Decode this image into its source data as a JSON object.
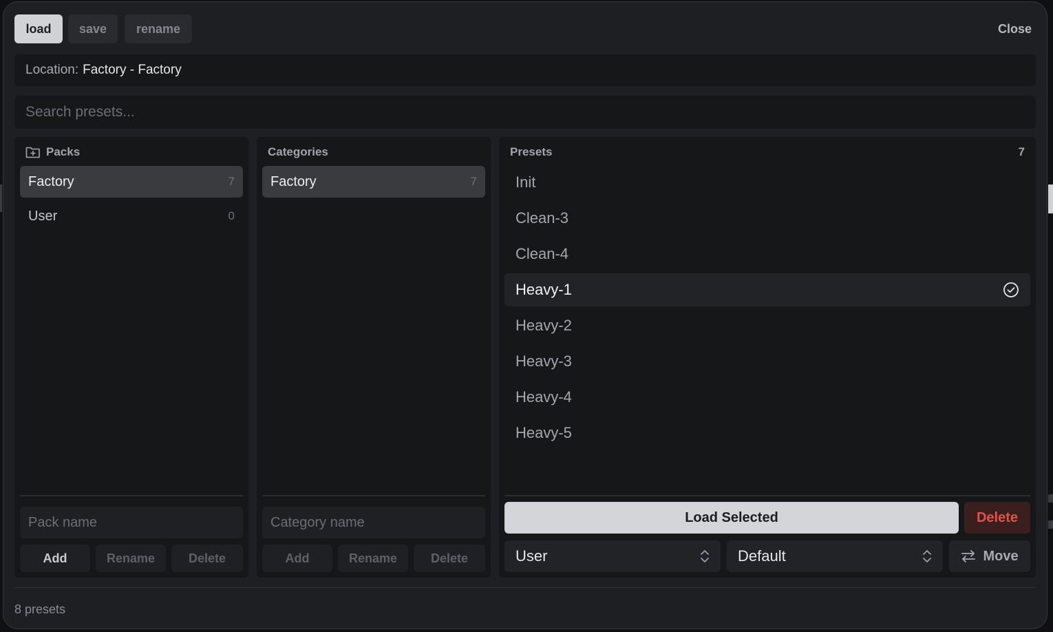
{
  "tabs": [
    {
      "label": "load"
    },
    {
      "label": "save"
    },
    {
      "label": "rename"
    }
  ],
  "close_label": "Close",
  "location": {
    "label": "Location:",
    "value": "Factory - Factory"
  },
  "search": {
    "placeholder": "Search presets..."
  },
  "packs": {
    "title": "Packs",
    "items": [
      {
        "label": "Factory",
        "count": "7"
      },
      {
        "label": "User",
        "count": "0"
      }
    ],
    "input_placeholder": "Pack name",
    "add_label": "Add",
    "rename_label": "Rename",
    "delete_label": "Delete"
  },
  "categories": {
    "title": "Categories",
    "items": [
      {
        "label": "Factory",
        "count": "7"
      }
    ],
    "input_placeholder": "Category name",
    "add_label": "Add",
    "rename_label": "Rename",
    "delete_label": "Delete"
  },
  "presets": {
    "title": "Presets",
    "count": "7",
    "items": [
      {
        "label": "Init"
      },
      {
        "label": "Clean-3"
      },
      {
        "label": "Clean-4"
      },
      {
        "label": "Heavy-1"
      },
      {
        "label": "Heavy-2"
      },
      {
        "label": "Heavy-3"
      },
      {
        "label": "Heavy-4"
      },
      {
        "label": "Heavy-5"
      }
    ],
    "selected": "Heavy-1",
    "load_label": "Load Selected",
    "delete_label": "Delete",
    "pack_select": "User",
    "category_select": "Default",
    "move_label": "Move"
  },
  "footer": {
    "text": "8 presets"
  },
  "colors": {
    "accent_delete": "#e0534b",
    "primary_button": "#d3d5d9"
  }
}
